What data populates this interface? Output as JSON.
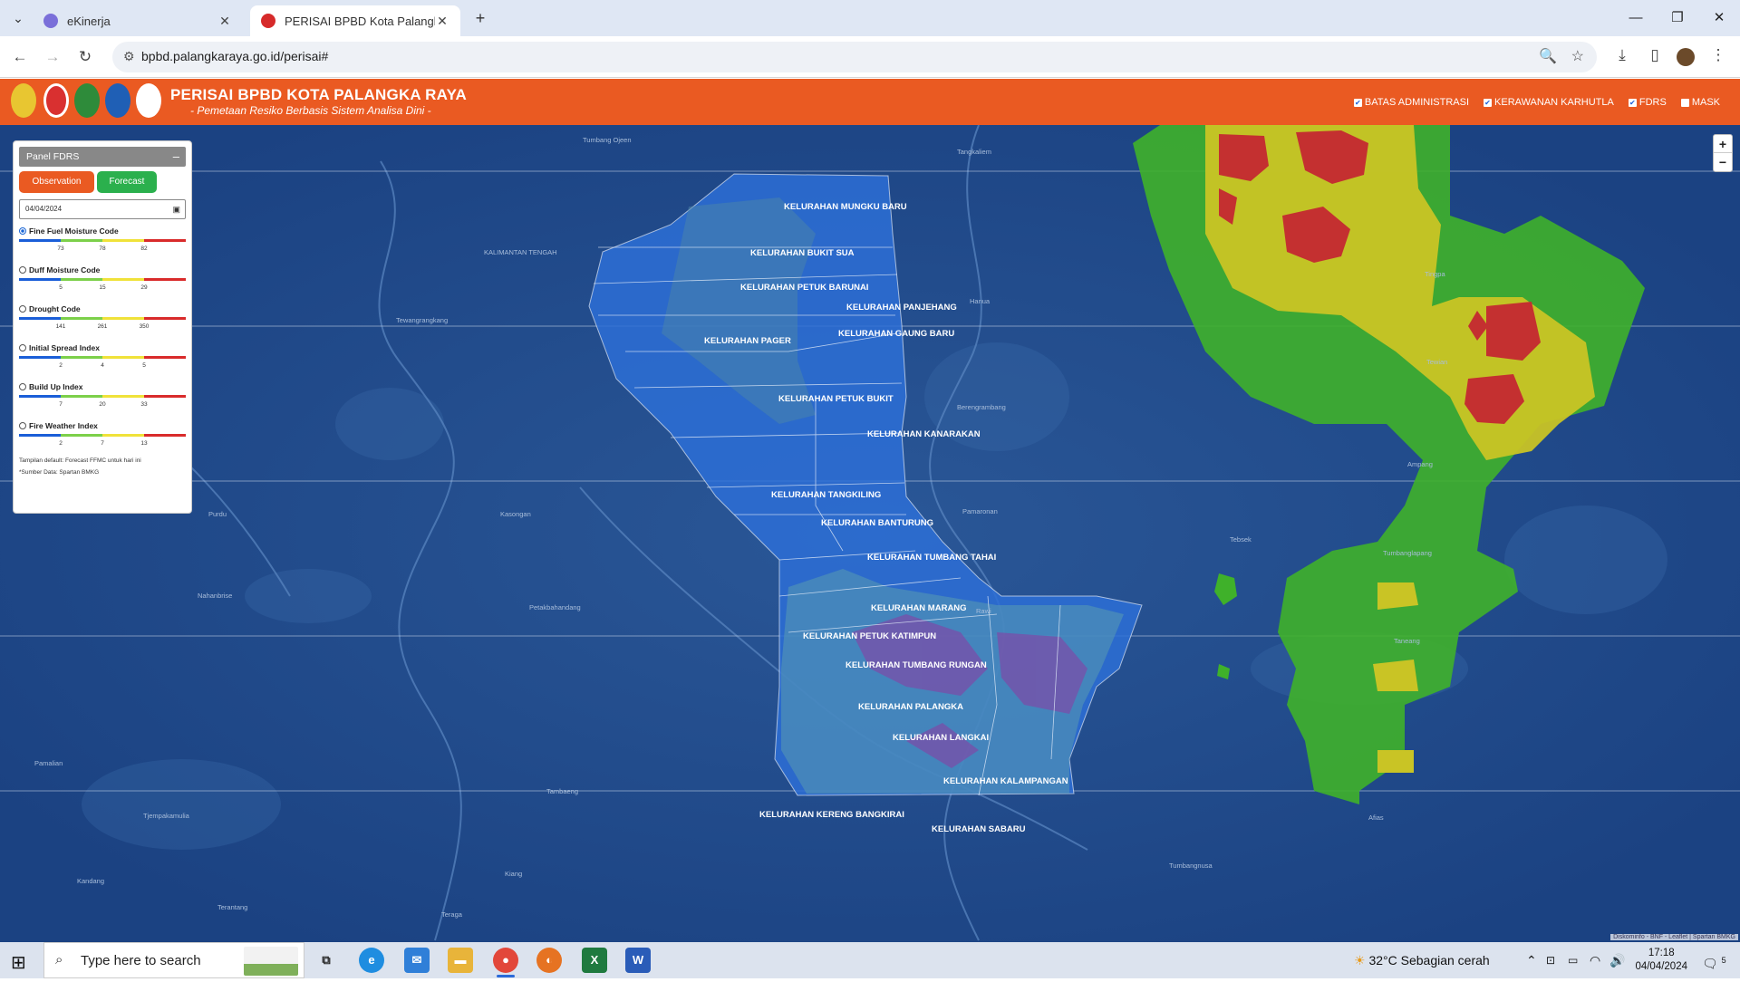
{
  "browser": {
    "tabs": [
      {
        "title": "eKinerja",
        "active": false
      },
      {
        "title": "PERISAI BPBD Kota Palangka Ra",
        "active": true
      }
    ],
    "url": "bpbd.palangkaraya.go.id/perisai#"
  },
  "site": {
    "title": "PERISAI BPBD KOTA PALANGKA RAYA",
    "subtitle": "- Pemetaan Resiko Berbasis Sistem Analisa Dini -",
    "layers": [
      {
        "label": "BATAS ADMINISTRASI",
        "checked": true
      },
      {
        "label": "KERAWANAN KARHUTLA",
        "checked": true
      },
      {
        "label": "FDRS",
        "checked": true
      },
      {
        "label": "MASK",
        "checked": false
      }
    ],
    "accent_color": "#ea5a22"
  },
  "panel": {
    "title": "Panel FDRS",
    "observation_label": "Observation",
    "forecast_label": "Forecast",
    "date_value": "04/04/2024",
    "indices": [
      {
        "name": "Fine Fuel Moisture Code",
        "selected": true,
        "ticks": [
          "73",
          "78",
          "82"
        ]
      },
      {
        "name": "Duff Moisture Code",
        "selected": false,
        "ticks": [
          "5",
          "15",
          "29"
        ]
      },
      {
        "name": "Drought Code",
        "selected": false,
        "ticks": [
          "141",
          "261",
          "350"
        ]
      },
      {
        "name": "Initial Spread Index",
        "selected": false,
        "ticks": [
          "2",
          "4",
          "5"
        ]
      },
      {
        "name": "Build Up Index",
        "selected": false,
        "ticks": [
          "7",
          "20",
          "33"
        ]
      },
      {
        "name": "Fire Weather Index",
        "selected": false,
        "ticks": [
          "2",
          "7",
          "13"
        ]
      }
    ],
    "note1": "Tampilan default: Forecast FFMC untuk hari ini",
    "note2": "*Sumber Data: Spartan BMKG",
    "scale_colors": [
      "#1a5ed8",
      "#7cd04a",
      "#f0e23a",
      "#d92b2b"
    ]
  },
  "map": {
    "kelurahan": [
      "KELURAHAN MUNGKU BARU",
      "KELURAHAN BUKIT SUA",
      "KELURAHAN PETUK BARUNAI",
      "KELURAHAN PANJEHANG",
      "KELURAHAN GAUNG BARU",
      "KELURAHAN PAGER",
      "KELURAHAN PETUK BUKIT",
      "KELURAHAN KANARAKAN",
      "KELURAHAN TANGKILING",
      "KELURAHAN BANTURUNG",
      "KELURAHAN TUMBANG TAHAI",
      "KELURAHAN MARANG",
      "KELURAHAN PETUK KATIMPUN",
      "KELURAHAN TUMBANG RUNGAN",
      "KELURAHAN PALANGKA",
      "KELURAHAN LANGKAI",
      "KELURAHAN KALAMPANGAN",
      "KELURAHAN KERENG BANGKIRAI",
      "KELURAHAN SABARU"
    ],
    "places": [
      "KALIMANTAN TENGAH",
      "Tumbang Ojeen",
      "Tewangrangkang",
      "Purdu",
      "Kasongan",
      "Nahanbrise",
      "Petakbahandang",
      "Pamalian",
      "Tjempakamulia",
      "Kandang",
      "Terantang",
      "Teraga",
      "Tambaeng",
      "Kiang",
      "Hanua",
      "Berengrambang",
      "Pamaronan",
      "Rawi",
      "Tumbangnusa",
      "Afias",
      "Tangkaliem",
      "Ampang",
      "Tebsek",
      "Tewian",
      "Tumbanglapang",
      "Taneang",
      "Tingpa"
    ],
    "attribution": "Diskominfo - BNF - Leaflet | Spartan BMKG",
    "zoom_in": "+",
    "zoom_out": "−"
  },
  "taskbar": {
    "search_placeholder": "Type here to search",
    "weather": "32°C  Sebagian cerah",
    "time": "17:18",
    "date": "04/04/2024",
    "notif_count": "5"
  }
}
